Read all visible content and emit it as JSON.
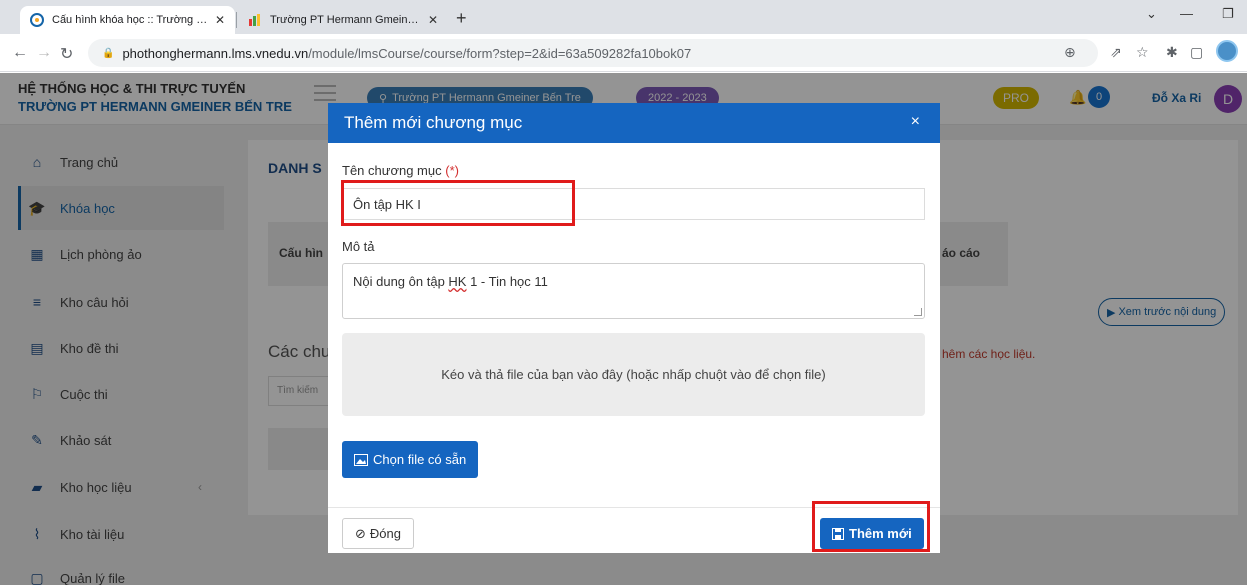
{
  "browser": {
    "tabs": [
      {
        "title": "Cấu hình khóa học :: Trường PT H",
        "close": "✕"
      },
      {
        "title": "Trường PT Hermann Gmeiner Bến",
        "close": "✕"
      }
    ],
    "new_tab": "+",
    "url_host": "phothonghermann.lms.vnedu.vn",
    "url_path": "/module/lmsCourse/course/form?step=2&id=63a509282fa10bok07"
  },
  "header": {
    "system_title": "HỆ THỐNG HỌC & THI TRỰC TUYẾN",
    "school_title": "TRƯỜNG PT HERMANN GMEINER BẾN TRE",
    "school_pill": "Trường PT Hermann Gmeiner Bến Tre",
    "year": "2022 - 2023",
    "pro": "PRO",
    "notification_count": "0",
    "user_name": "Đỗ Xa Ri",
    "user_initial": "D"
  },
  "sidebar": {
    "items": [
      {
        "label": "Trang chủ",
        "icon": "home-icon"
      },
      {
        "label": "Khóa học",
        "icon": "graduation-cap-icon"
      },
      {
        "label": "Lịch phòng ảo",
        "icon": "calendar-icon"
      },
      {
        "label": "Kho câu hỏi",
        "icon": "database-icon"
      },
      {
        "label": "Kho đề thi",
        "icon": "file-icon"
      },
      {
        "label": "Cuộc thi",
        "icon": "contest-icon"
      },
      {
        "label": "Khảo sát",
        "icon": "survey-icon"
      },
      {
        "label": "Kho học liệu",
        "icon": "book-icon"
      },
      {
        "label": "Kho tài liệu",
        "icon": "paperclip-icon"
      },
      {
        "label": "Quản lý file",
        "icon": "file-manager-icon"
      }
    ]
  },
  "background": {
    "title": "DANH S",
    "step_label": "Cấu hìn",
    "step_label_right": "áo cáo",
    "preview": "Xem trước nội dung",
    "section": "Các chu",
    "note": "hêm các học liệu.",
    "search_placeholder": "Tìm kiếm"
  },
  "modal": {
    "title": "Thêm mới chương mục",
    "close": "×",
    "name_label": "Tên chương mục",
    "required": "(*)",
    "name_value": "Ôn tập HK I",
    "desc_label": "Mô tả",
    "desc_pre": "Nội dung ôn tập ",
    "desc_sq": "HK",
    "desc_post": " 1 - Tin học 11",
    "dropzone": "Kéo và thả file của bạn vào đây (hoặc nhấp chuột vào để chọn file)",
    "choose_file": "Chọn file có sẵn",
    "close_btn": "Đóng",
    "add_btn": "Thêm mới"
  },
  "colors": {
    "primary": "#1565c0",
    "highlight": "#e01b1b"
  }
}
